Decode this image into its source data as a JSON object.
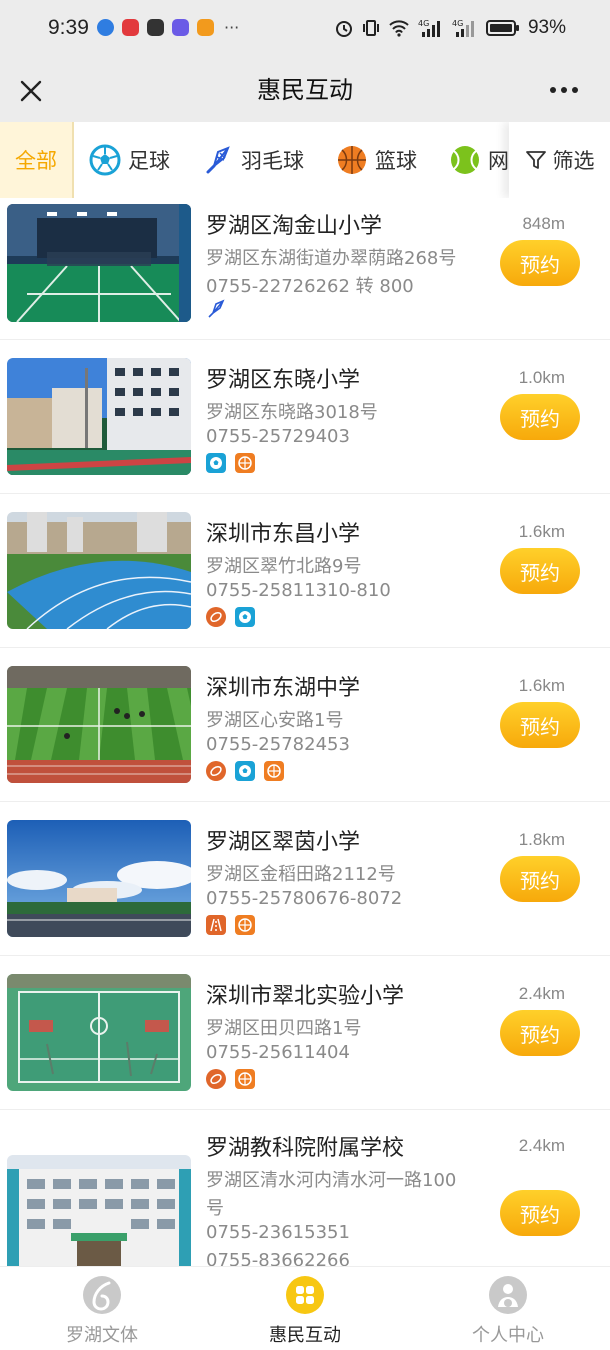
{
  "status_bar": {
    "time": "9:39",
    "more": "···",
    "battery": "93%",
    "signal_labels": [
      "4G",
      "4G"
    ]
  },
  "header": {
    "title": "惠民互动",
    "close_icon": "close-icon",
    "more_icon": "more-icon"
  },
  "tabs": [
    {
      "label": "全部",
      "icon": "",
      "active": true
    },
    {
      "label": "足球",
      "icon": "soccer-icon"
    },
    {
      "label": "羽毛球",
      "icon": "badminton-icon"
    },
    {
      "label": "篮球",
      "icon": "basketball-icon"
    },
    {
      "label": "网球",
      "icon": "tennis-icon"
    }
  ],
  "filter": {
    "label": "筛选",
    "icon": "filter-icon"
  },
  "book_label": "预约",
  "venues": [
    {
      "name": "罗湖区淘金山小学",
      "address": "罗湖区东湖街道办翠荫路268号",
      "phones": [
        "0755-22726262 转 800"
      ],
      "distance": "848m",
      "tags": [
        "badminton"
      ]
    },
    {
      "name": "罗湖区东晓小学",
      "address": "罗湖区东晓路3018号",
      "phones": [
        "0755-25729403"
      ],
      "distance": "1.0km",
      "tags": [
        "soccer",
        "basketball"
      ]
    },
    {
      "name": "深圳市东昌小学",
      "address": "罗湖区翠竹北路9号",
      "phones": [
        "0755-25811310-810"
      ],
      "distance": "1.6km",
      "tags": [
        "track",
        "soccer"
      ]
    },
    {
      "name": "深圳市东湖中学",
      "address": "罗湖区心安路1号",
      "phones": [
        "0755-25782453"
      ],
      "distance": "1.6km",
      "tags": [
        "track",
        "soccer",
        "basketball"
      ]
    },
    {
      "name": "罗湖区翠茵小学",
      "address": "罗湖区金稻田路2112号",
      "phones": [
        "0755-25780676-8072"
      ],
      "distance": "1.8km",
      "tags": [
        "running",
        "basketball"
      ]
    },
    {
      "name": "深圳市翠北实验小学",
      "address": "罗湖区田贝四路1号",
      "phones": [
        "0755-25611404"
      ],
      "distance": "2.4km",
      "tags": [
        "track",
        "basketball"
      ]
    },
    {
      "name": "罗湖教科院附属学校",
      "address": "罗湖区清水河内清水河一路100",
      "address_cont": "号",
      "phones": [
        "0755-23615351",
        "0755-83662266"
      ],
      "distance": "2.4km",
      "tags": []
    }
  ],
  "bottom_nav": [
    {
      "label": "罗湖文体",
      "icon": "luohu-culture-icon",
      "active": false
    },
    {
      "label": "惠民互动",
      "icon": "interaction-icon",
      "active": true
    },
    {
      "label": "个人中心",
      "icon": "user-center-icon",
      "active": false
    }
  ],
  "colors": {
    "accent": "#f7a90b",
    "accent_light": "#ffd02a",
    "tab_bg_active": "#fff5d9",
    "tag_soccer": "#1aa2d6",
    "tag_basketball": "#ef7d22",
    "tag_track": "#e0662a"
  }
}
